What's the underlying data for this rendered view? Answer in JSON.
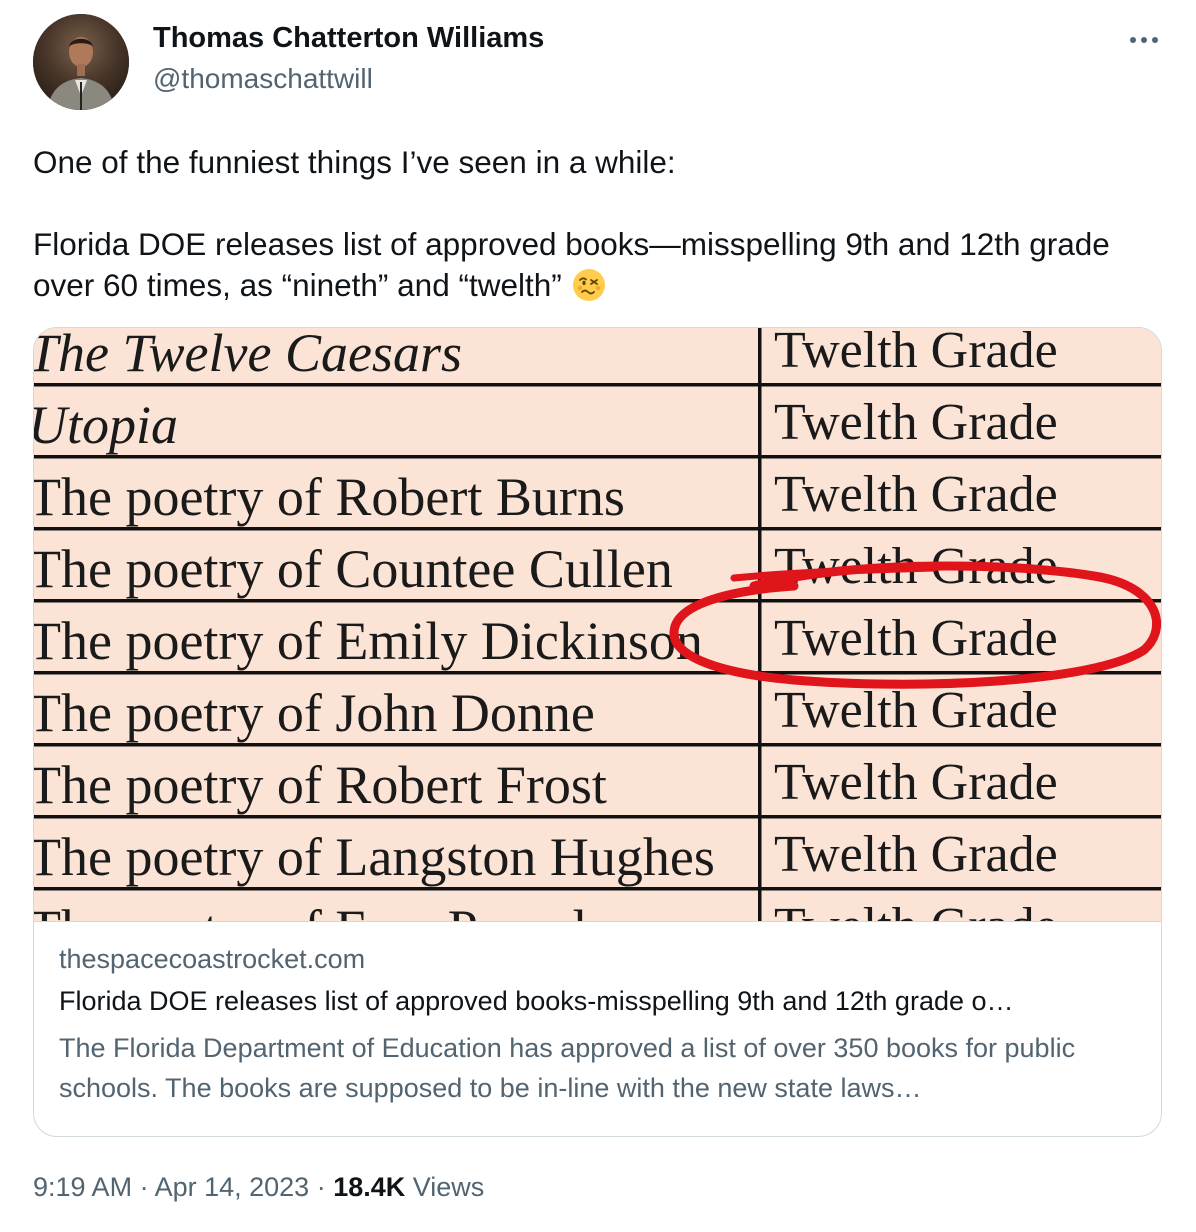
{
  "author": {
    "name": "Thomas Chatterton Williams",
    "handle": "@thomaschattwill"
  },
  "more_icon": "more-horizontal-icon",
  "tweet": {
    "line1": "One of the funniest things I’ve seen in a while:",
    "line2": "Florida DOE releases list of approved books—misspelling 9th and 12th grade over 60 times, as “nineth” and “twelth”",
    "emoji": "woozy-face-emoji"
  },
  "card": {
    "table_rows": [
      {
        "title": "The Twelve Caesars",
        "grade": "Twelth Grade"
      },
      {
        "title": "Utopia",
        "grade": "Twelth Grade"
      },
      {
        "title": "The poetry of Robert Burns",
        "grade": "Twelth Grade"
      },
      {
        "title": "The poetry of Countee Cullen",
        "grade": "Twelth Grade"
      },
      {
        "title": "The poetry of Emily Dickinson",
        "grade": "Twelth Grade"
      },
      {
        "title": "The poetry of John Donne",
        "grade": "Twelth Grade"
      },
      {
        "title": "The poetry of Robert Frost",
        "grade": "Twelth Grade"
      },
      {
        "title": "The poetry of Langston Hughes",
        "grade": "Twelth Grade"
      },
      {
        "title": "The poetry of Ezra Pound",
        "grade": "Twelth Grade"
      }
    ],
    "highlight_color": "#e0141b",
    "domain": "thespacecoastrocket.com",
    "title": "Florida DOE releases list of approved books-misspelling 9th and 12th grade o…",
    "description": "The Florida Department of Education has approved a list of over 350 books for public schools. The books are supposed to be in-line with the new state laws…"
  },
  "meta": {
    "time": "9:19 AM",
    "sep1": " · ",
    "date": "Apr 14, 2023",
    "sep2": " · ",
    "views_count": "18.4K",
    "views_label": " Views"
  }
}
